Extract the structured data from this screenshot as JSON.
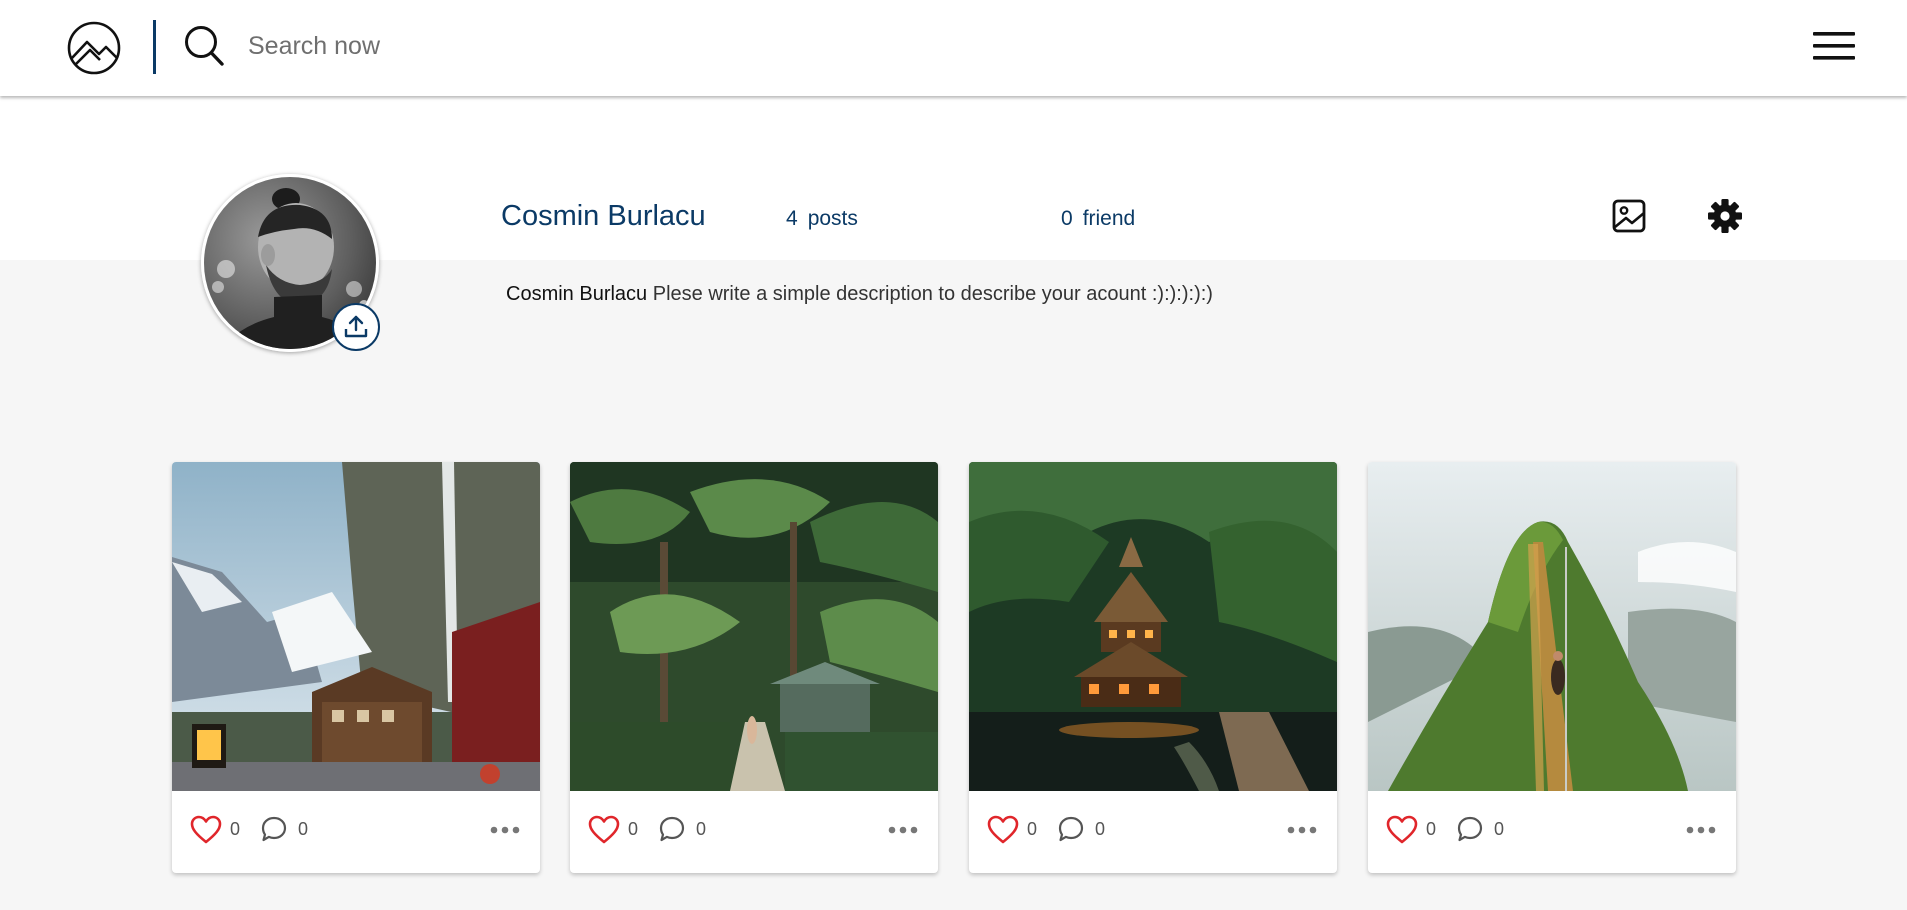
{
  "nav": {
    "search_placeholder": "Search now"
  },
  "colors": {
    "brand": "#0b3a66",
    "like": "#e0262b",
    "background": "#f6f6f6"
  },
  "profile": {
    "name": "Cosmin Burlacu",
    "posts_count": "4",
    "posts_label": "posts",
    "friends_count": "0",
    "friends_label": "friend",
    "bio_name": "Cosmin Burlacu",
    "bio_text": "Plese write a simple description to describe your acount :):):):):)"
  },
  "icons": {
    "logo": "mountain-circle-logo",
    "search": "search-icon",
    "menu": "hamburger-menu-icon",
    "upload": "upload-icon",
    "gallery": "image-icon",
    "settings": "gear-icon",
    "like": "heart-icon",
    "comment": "comment-icon",
    "more": "ellipsis-icon"
  },
  "posts": [
    {
      "scene": "alpine-village-waterfall",
      "likes": "0",
      "comments": "0"
    },
    {
      "scene": "jungle-path",
      "likes": "0",
      "comments": "0"
    },
    {
      "scene": "treehouse-lagoon",
      "likes": "0",
      "comments": "0"
    },
    {
      "scene": "mountain-stairway",
      "likes": "0",
      "comments": "0"
    }
  ]
}
